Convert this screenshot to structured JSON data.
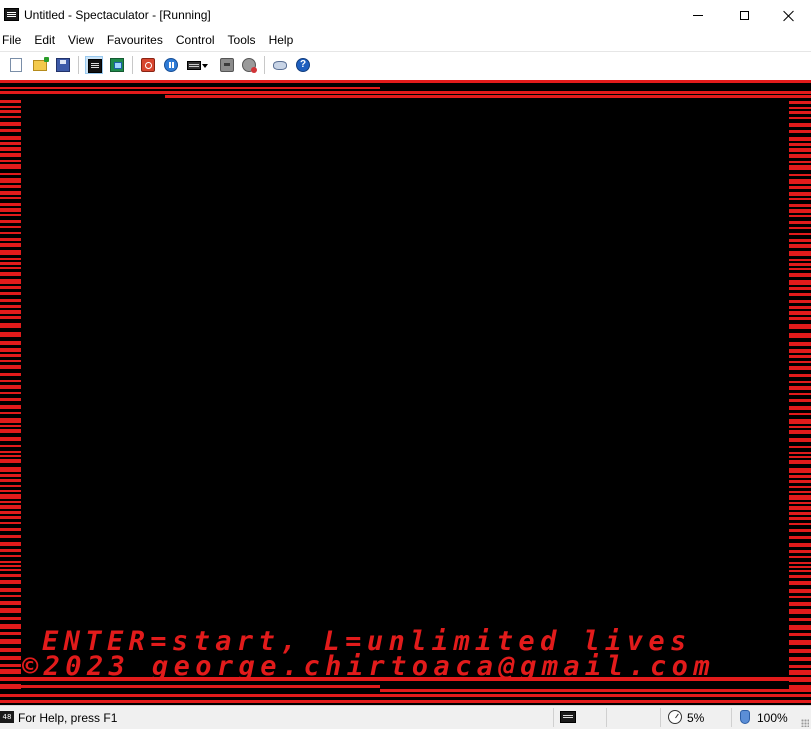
{
  "window": {
    "title": "Untitled - Spectaculator - [Running]",
    "controls": {
      "minimize": "minimize-icon",
      "maximize": "maximize-icon",
      "close": "close-icon"
    }
  },
  "menubar": {
    "items": [
      "File",
      "Edit",
      "View",
      "Favourites",
      "Control",
      "Tools",
      "Help"
    ]
  },
  "toolbar": {
    "buttons": [
      "new-file-icon",
      "open-file-icon",
      "save-icon",
      "full-screen-icon",
      "window-mode-icon",
      "reset-icon",
      "pause-icon",
      "keyboard-icon",
      "tape-icon",
      "disk-icon",
      "joystick-icon",
      "help-icon"
    ],
    "pressed": "full-screen-icon"
  },
  "display": {
    "line1": "ENTER=start, L=unlimited lives",
    "line2": "©2023 george.chirtoaca@gmail.com",
    "colors": {
      "border": "#e21b1b",
      "paper": "#000000",
      "ink": "#e21b1b"
    }
  },
  "statusbar": {
    "model_icon_label": "48",
    "help_text": "For Help, press F1",
    "speed": "5%",
    "volume": "100%"
  }
}
